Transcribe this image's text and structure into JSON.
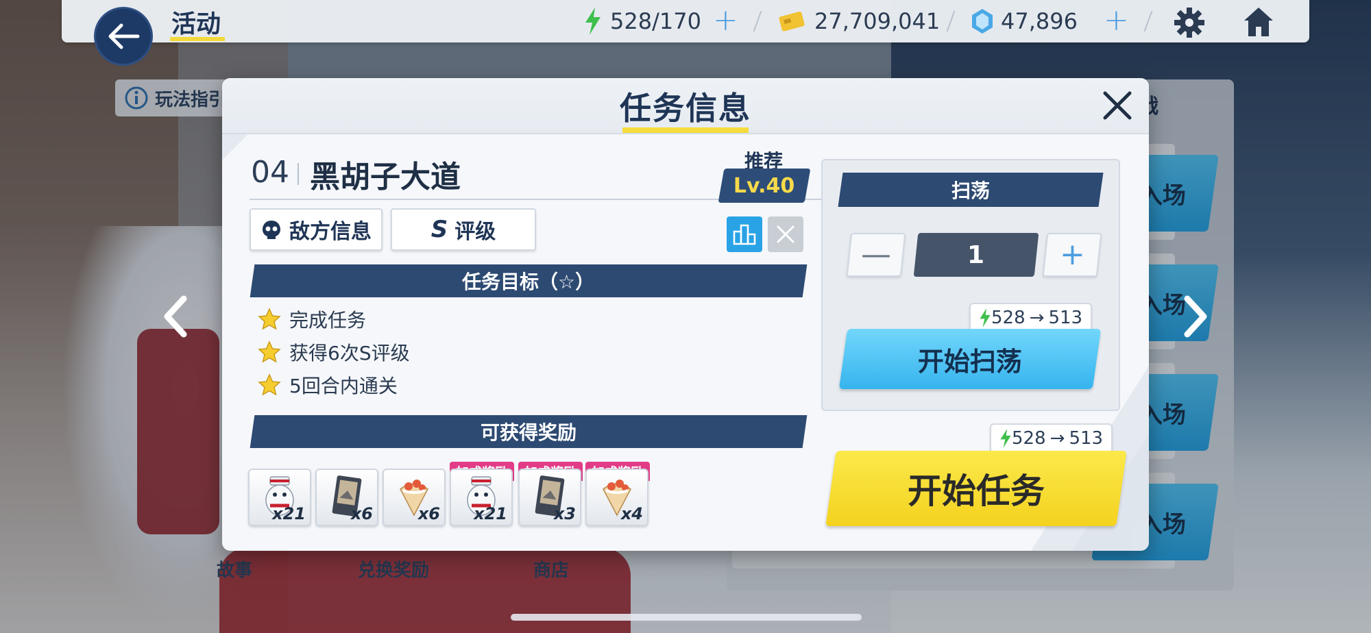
{
  "header": {
    "title": "活动",
    "stamina": "528/170",
    "credits": "27,709,041",
    "gems": "47,896"
  },
  "background": {
    "guide_label": "玩法指引",
    "right_header": "战",
    "enter_label": "入场",
    "bottom_nav": [
      "故事",
      "兑换奖励",
      "商店"
    ]
  },
  "modal": {
    "title": "任务信息",
    "stage_number": "04",
    "stage_name": "黑胡子大道",
    "recommend_label": "推荐",
    "recommend_level": "Lv.40",
    "enemy_info_label": "敌方信息",
    "rating_label": "评级",
    "rating_mark": "S",
    "objectives_header": "任务目标（☆）",
    "objectives": [
      "完成任务",
      "获得6次S评级",
      "5回合内通关"
    ],
    "rewards_header": "可获得奖励",
    "rewards": [
      {
        "qty": "x21",
        "bonus": false,
        "icon": "mascot-figure-icon"
      },
      {
        "qty": "x6",
        "bonus": false,
        "icon": "tactical-card-icon"
      },
      {
        "qty": "x6",
        "bonus": false,
        "icon": "crepe-food-icon"
      },
      {
        "qty": "x21",
        "bonus": true,
        "icon": "mascot-figure-icon"
      },
      {
        "qty": "x3",
        "bonus": true,
        "icon": "tactical-card-icon"
      },
      {
        "qty": "x4",
        "bonus": true,
        "icon": "crepe-food-icon"
      }
    ],
    "bonus_tag": "加成奖励",
    "sweep": {
      "header": "扫荡",
      "quantity": "1",
      "cost_from": "528",
      "cost_to": "513",
      "button_label": "开始扫荡"
    },
    "start": {
      "cost_from": "528",
      "cost_to": "513",
      "button_label": "开始任务"
    }
  },
  "colors": {
    "navy": "#2d4a72",
    "accent_yellow": "#f4dc3d",
    "sweep_blue": "#36b4ee",
    "bonus_pink": "#e23c87",
    "stamina_green": "#3fbf4c"
  }
}
